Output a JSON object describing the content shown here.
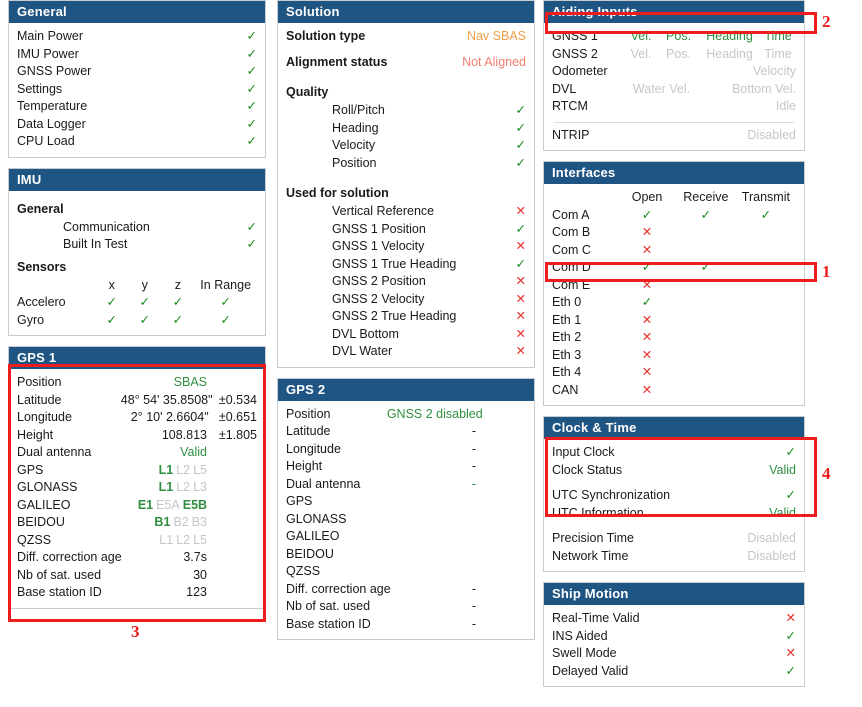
{
  "panels": {
    "general": {
      "title": "General",
      "items": [
        {
          "label": "Main Power",
          "status": "ok"
        },
        {
          "label": "IMU Power",
          "status": "ok"
        },
        {
          "label": "GNSS Power",
          "status": "ok"
        },
        {
          "label": "Settings",
          "status": "ok"
        },
        {
          "label": "Temperature",
          "status": "ok"
        },
        {
          "label": "Data Logger",
          "status": "ok"
        },
        {
          "label": "CPU Load",
          "status": "ok"
        }
      ]
    },
    "imu": {
      "title": "IMU",
      "general_label": "General",
      "general_items": [
        {
          "label": "Communication",
          "status": "ok"
        },
        {
          "label": "Built In Test",
          "status": "ok"
        }
      ],
      "sensors_label": "Sensors",
      "sensor_columns": [
        "x",
        "y",
        "z",
        "In Range"
      ],
      "sensors": [
        {
          "name": "Accelero",
          "x": "ok",
          "y": "ok",
          "z": "ok",
          "in_range": "ok"
        },
        {
          "name": "Gyro",
          "x": "ok",
          "y": "ok",
          "z": "ok",
          "in_range": "ok"
        }
      ]
    },
    "gps1": {
      "title": "GPS 1",
      "position_label": "Position",
      "position_value": "SBAS",
      "latitude_label": "Latitude",
      "latitude_value": "48° 54' 35.8508\"",
      "latitude_accuracy": "±0.534",
      "longitude_label": "Longitude",
      "longitude_value": "2° 10' 2.6604\"",
      "longitude_accuracy": "±0.651",
      "height_label": "Height",
      "height_value": "108.813",
      "height_accuracy": "±1.805",
      "dual_antenna_label": "Dual antenna",
      "dual_antenna_value": "Valid",
      "constellations": [
        {
          "name": "GPS",
          "bands": [
            {
              "t": "L1",
              "on": true
            },
            {
              "t": "L2",
              "on": false
            },
            {
              "t": "L5",
              "on": false
            }
          ]
        },
        {
          "name": "GLONASS",
          "bands": [
            {
              "t": "L1",
              "on": true
            },
            {
              "t": "L2",
              "on": false
            },
            {
              "t": "L3",
              "on": false
            }
          ]
        },
        {
          "name": "GALILEO",
          "bands": [
            {
              "t": "E1",
              "on": true
            },
            {
              "t": "E5A",
              "on": false
            },
            {
              "t": "E5B",
              "on": true
            }
          ]
        },
        {
          "name": "BEIDOU",
          "bands": [
            {
              "t": "B1",
              "on": true
            },
            {
              "t": "B2",
              "on": false
            },
            {
              "t": "B3",
              "on": false
            }
          ]
        },
        {
          "name": "QZSS",
          "bands": [
            {
              "t": "L1",
              "on": false
            },
            {
              "t": "L2",
              "on": false
            },
            {
              "t": "L5",
              "on": false
            }
          ]
        }
      ],
      "diff_age_label": "Diff. correction age",
      "diff_age_value": "3.7s",
      "nb_sat_label": "Nb of sat. used",
      "nb_sat_value": "30",
      "base_station_label": "Base station ID",
      "base_station_value": "123"
    },
    "solution": {
      "title": "Solution",
      "solution_type_label": "Solution type",
      "solution_type_value": "Nav SBAS",
      "alignment_label": "Alignment status",
      "alignment_value": "Not Aligned",
      "quality_label": "Quality",
      "quality": [
        {
          "label": "Roll/Pitch",
          "status": "ok"
        },
        {
          "label": "Heading",
          "status": "ok"
        },
        {
          "label": "Velocity",
          "status": "ok"
        },
        {
          "label": "Position",
          "status": "ok"
        }
      ],
      "used_label": "Used for solution",
      "used": [
        {
          "label": "Vertical Reference",
          "status": "no"
        },
        {
          "label": "GNSS 1 Position",
          "status": "ok"
        },
        {
          "label": "GNSS 1 Velocity",
          "status": "no"
        },
        {
          "label": "GNSS 1 True Heading",
          "status": "ok"
        },
        {
          "label": "GNSS 2 Position",
          "status": "no"
        },
        {
          "label": "GNSS 2 Velocity",
          "status": "no"
        },
        {
          "label": "GNSS 2 True Heading",
          "status": "no"
        },
        {
          "label": "DVL Bottom",
          "status": "no"
        },
        {
          "label": "DVL Water",
          "status": "no"
        }
      ]
    },
    "gps2": {
      "title": "GPS 2",
      "position_label": "Position",
      "position_value": "GNSS 2 disabled",
      "latitude_label": "Latitude",
      "latitude_value": "-",
      "longitude_label": "Longitude",
      "longitude_value": "-",
      "height_label": "Height",
      "height_value": "-",
      "dual_antenna_label": "Dual antenna",
      "dual_antenna_value": "-",
      "constellations": [
        {
          "name": "GPS"
        },
        {
          "name": "GLONASS"
        },
        {
          "name": "GALILEO"
        },
        {
          "name": "BEIDOU"
        },
        {
          "name": "QZSS"
        }
      ],
      "diff_age_label": "Diff. correction age",
      "diff_age_value": "-",
      "nb_sat_label": "Nb of sat. used",
      "nb_sat_value": "-",
      "base_station_label": "Base station ID",
      "base_station_value": "-"
    },
    "aiding": {
      "title": "Aiding Inputs",
      "rows": [
        {
          "name": "GNSS 1",
          "cells": [
            {
              "t": "Vel.",
              "on": true
            },
            {
              "t": "Pos.",
              "on": true
            },
            {
              "t": "Heading",
              "on": true
            },
            {
              "t": "Time",
              "on": true
            }
          ]
        },
        {
          "name": "GNSS 2",
          "cells": [
            {
              "t": "Vel.",
              "on": false
            },
            {
              "t": "Pos.",
              "on": false
            },
            {
              "t": "Heading",
              "on": false
            },
            {
              "t": "Time",
              "on": false
            }
          ]
        },
        {
          "name": "Odometer",
          "right": {
            "t": "Velocity",
            "on": false
          }
        },
        {
          "name": "DVL",
          "cells_two": [
            {
              "t": "Water Vel.",
              "on": false
            },
            {
              "t": "Bottom Vel.",
              "on": false
            }
          ]
        },
        {
          "name": "RTCM",
          "right": {
            "t": "Idle",
            "on": false
          }
        }
      ],
      "ntrip_label": "NTRIP",
      "ntrip_value": "Disabled"
    },
    "interfaces": {
      "title": "Interfaces",
      "columns": [
        "Open",
        "Receive",
        "Transmit"
      ],
      "rows": [
        {
          "name": "Com A",
          "open": "ok",
          "receive": "ok",
          "transmit": "ok"
        },
        {
          "name": "Com B",
          "open": "no",
          "receive": "none",
          "transmit": "none"
        },
        {
          "name": "Com C",
          "open": "no",
          "receive": "none",
          "transmit": "none"
        },
        {
          "name": "Com D",
          "open": "ok",
          "receive": "ok",
          "transmit": "none"
        },
        {
          "name": "Com E",
          "open": "no",
          "receive": "none",
          "transmit": "none"
        },
        {
          "name": "Eth 0",
          "open": "ok",
          "receive": "none",
          "transmit": "none"
        },
        {
          "name": "Eth 1",
          "open": "no",
          "receive": "none",
          "transmit": "none"
        },
        {
          "name": "Eth 2",
          "open": "no",
          "receive": "none",
          "transmit": "none"
        },
        {
          "name": "Eth 3",
          "open": "no",
          "receive": "none",
          "transmit": "none"
        },
        {
          "name": "Eth 4",
          "open": "no",
          "receive": "none",
          "transmit": "none"
        },
        {
          "name": "CAN",
          "open": "no",
          "receive": "none",
          "transmit": "none"
        }
      ]
    },
    "clock": {
      "title": "Clock & Time",
      "input_clock_label": "Input Clock",
      "input_clock_status": "ok",
      "clock_status_label": "Clock Status",
      "clock_status_value": "Valid",
      "utc_sync_label": "UTC Synchronization",
      "utc_sync_status": "ok",
      "utc_info_label": "UTC Information",
      "utc_info_value": "Valid",
      "precision_time_label": "Precision Time",
      "precision_time_value": "Disabled",
      "network_time_label": "Network Time",
      "network_time_value": "Disabled"
    },
    "ship": {
      "title": "Ship Motion",
      "items": [
        {
          "label": "Real-Time Valid",
          "status": "no"
        },
        {
          "label": "INS Aided",
          "status": "ok"
        },
        {
          "label": "Swell Mode",
          "status": "no"
        },
        {
          "label": "Delayed Valid",
          "status": "ok"
        }
      ]
    }
  },
  "annotations": [
    {
      "id": "1",
      "label": "1"
    },
    {
      "id": "2",
      "label": "2"
    },
    {
      "id": "3",
      "label": "3"
    },
    {
      "id": "4",
      "label": "4"
    }
  ],
  "glyphs": {
    "ok": "✓",
    "no": "✕"
  },
  "colors": {
    "header_bg": "#1f5582",
    "ok": "#178a17",
    "no": "#e8312a",
    "green_text": "#2f8f3f",
    "orange_text": "#f0a04a",
    "salmon_text": "#f08070",
    "grey_text": "#c3c7cb",
    "annotation": "#ee1c1c"
  }
}
